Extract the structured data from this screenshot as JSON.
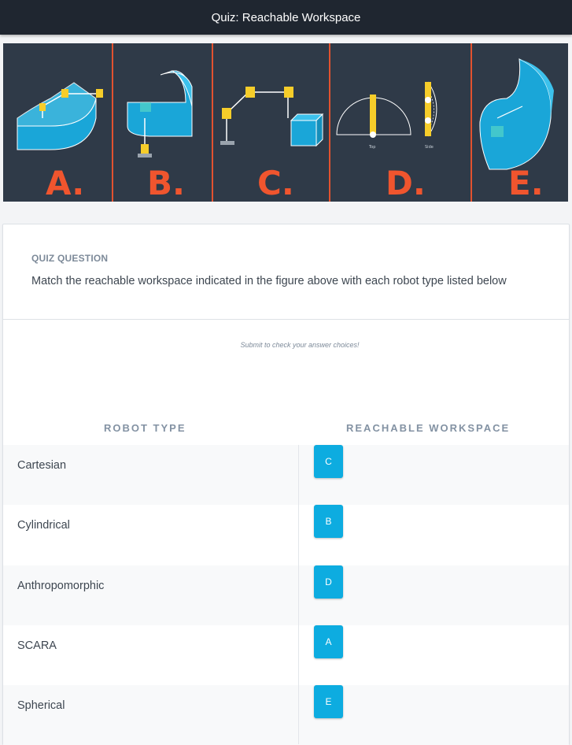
{
  "header": {
    "title": "Quiz: Reachable Workspace"
  },
  "figure": {
    "panel_letters": [
      "A.",
      "B.",
      "C.",
      "D.",
      "E."
    ],
    "panel_d_captions": {
      "top": "Top",
      "side": "Side"
    },
    "colors": {
      "background": "#2f3a48",
      "divider": "#e2522f",
      "letter": "#f0552e",
      "workspace": "#1aa6d8",
      "joint": "#f6cd2a"
    }
  },
  "quiz": {
    "label": "QUIZ QUESTION",
    "question": "Match the reachable workspace indicated in the figure above with each robot type listed below",
    "hint": "Submit to check your answer choices!",
    "columns": {
      "left": "ROBOT TYPE",
      "right": "REACHABLE WORKSPACE"
    },
    "rows": [
      {
        "robot": "Cartesian",
        "answer": "C"
      },
      {
        "robot": "Cylindrical",
        "answer": "B"
      },
      {
        "robot": "Anthropomorphic",
        "answer": "D"
      },
      {
        "robot": "SCARA",
        "answer": "A"
      },
      {
        "robot": "Spherical",
        "answer": "E"
      }
    ]
  },
  "colors": {
    "topbar": "#1f2630",
    "chip": "#0dace0",
    "label": "#7d8a99"
  }
}
